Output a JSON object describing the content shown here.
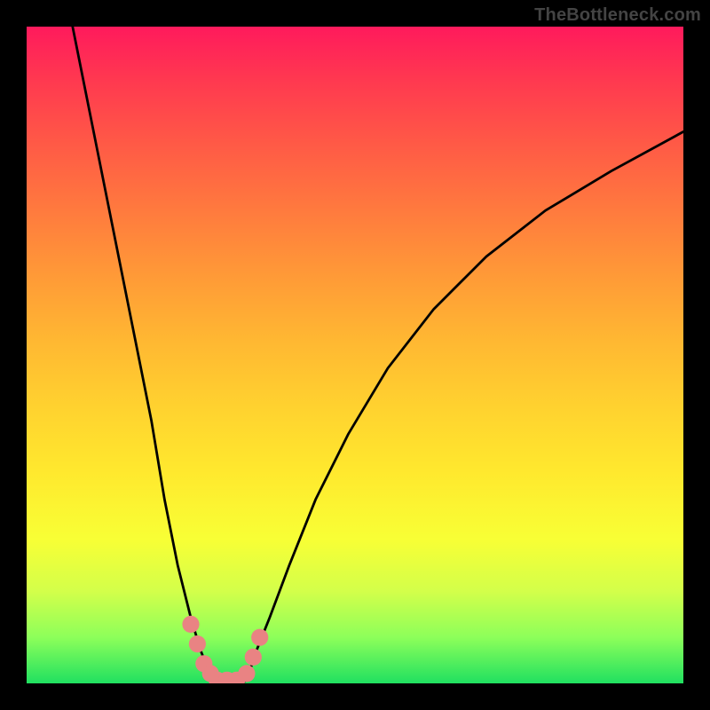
{
  "watermark": "TheBottleneck.com",
  "chart_data": {
    "type": "line",
    "title": "",
    "xlabel": "",
    "ylabel": "",
    "xlim": [
      0,
      100
    ],
    "ylim": [
      0,
      100
    ],
    "legend": false,
    "grid": false,
    "background_gradient": {
      "direction": "vertical",
      "stops": [
        {
          "pos": 0,
          "color": "#ff1a5c"
        },
        {
          "pos": 50,
          "color": "#ffb832"
        },
        {
          "pos": 80,
          "color": "#f8ff35"
        },
        {
          "pos": 100,
          "color": "#20e060"
        }
      ]
    },
    "series": [
      {
        "name": "left-arm",
        "x": [
          7,
          10,
          13,
          16,
          19,
          21,
          23,
          25,
          26.5,
          27.5,
          28.5,
          29
        ],
        "values": [
          100,
          85,
          70,
          55,
          40,
          28,
          18,
          10,
          5,
          2.5,
          1,
          0
        ]
      },
      {
        "name": "right-arm",
        "x": [
          33,
          34,
          35,
          37,
          40,
          44,
          49,
          55,
          62,
          70,
          79,
          89,
          100
        ],
        "values": [
          0,
          2,
          5,
          10,
          18,
          28,
          38,
          48,
          57,
          65,
          72,
          78,
          84
        ]
      }
    ],
    "markers": [
      {
        "name": "red-dot",
        "x": 25.0,
        "y": 9,
        "r": 6,
        "color": "#e98383"
      },
      {
        "name": "red-dot",
        "x": 26.0,
        "y": 6,
        "r": 6,
        "color": "#e98383"
      },
      {
        "name": "red-dot",
        "x": 27.0,
        "y": 3,
        "r": 6,
        "color": "#e98383"
      },
      {
        "name": "red-dot",
        "x": 28.0,
        "y": 1.5,
        "r": 6,
        "color": "#e98383"
      },
      {
        "name": "red-dot",
        "x": 29.0,
        "y": 0.5,
        "r": 6,
        "color": "#e98383"
      },
      {
        "name": "red-dot",
        "x": 30.5,
        "y": 0.5,
        "r": 6,
        "color": "#e98383"
      },
      {
        "name": "red-dot",
        "x": 32.0,
        "y": 0.5,
        "r": 6,
        "color": "#e98383"
      },
      {
        "name": "red-dot",
        "x": 33.5,
        "y": 1.5,
        "r": 6,
        "color": "#e98383"
      },
      {
        "name": "red-dot",
        "x": 34.5,
        "y": 4,
        "r": 6,
        "color": "#e98383"
      },
      {
        "name": "red-dot",
        "x": 35.5,
        "y": 7,
        "r": 6,
        "color": "#e98383"
      }
    ]
  }
}
